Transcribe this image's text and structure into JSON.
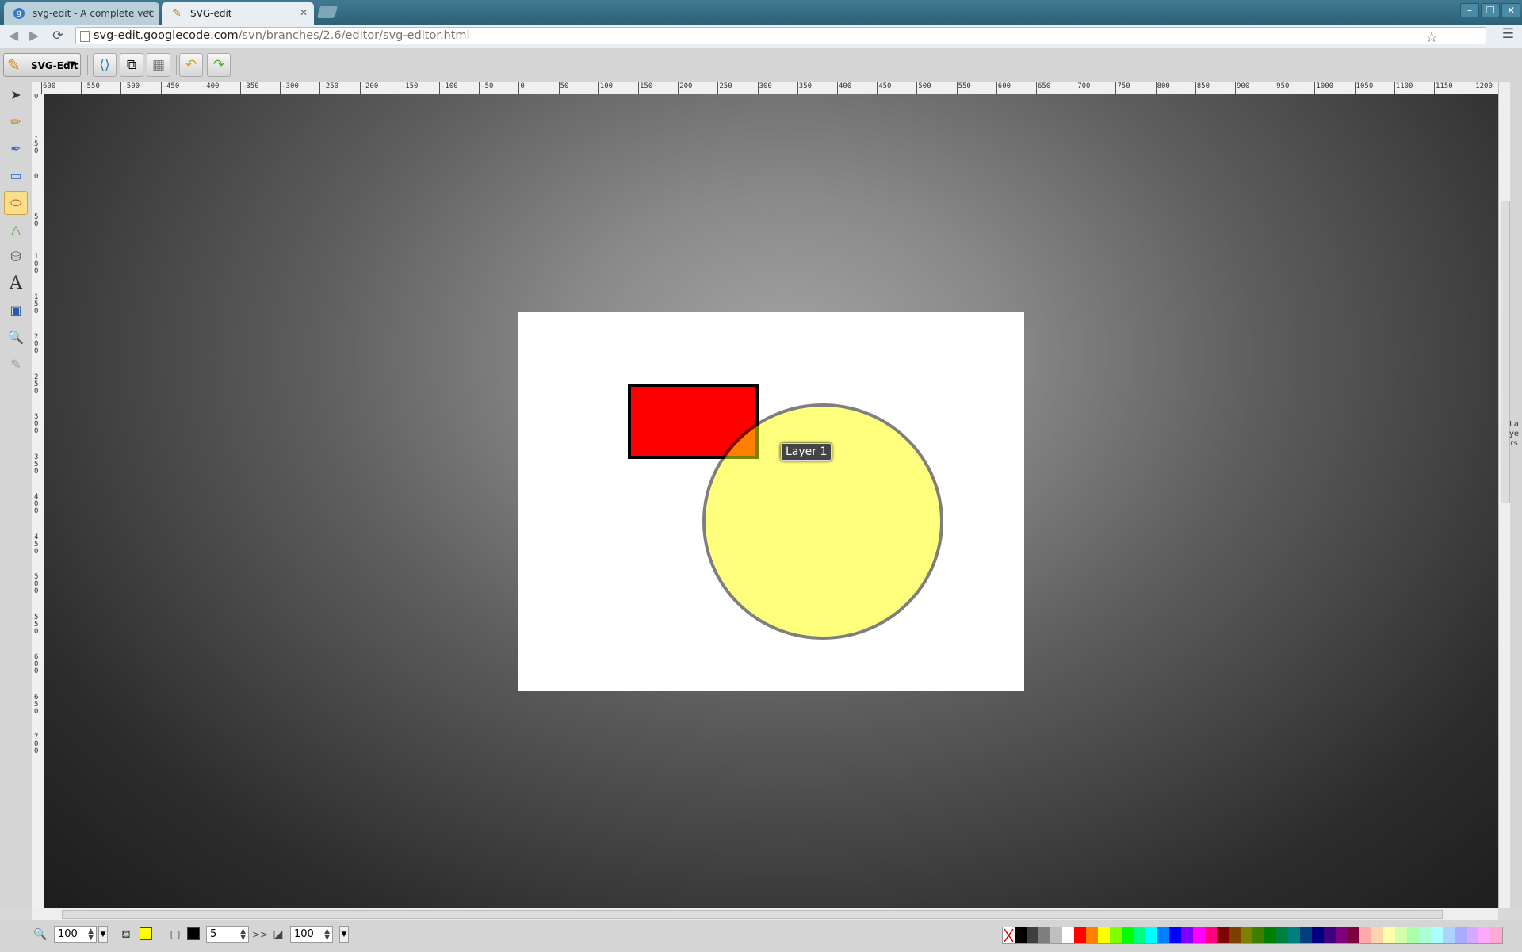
{
  "browser": {
    "tabs": [
      {
        "label": "svg-edit - A complete vec",
        "favicon": "google-code"
      },
      {
        "label": "SVG-edit",
        "favicon": "svg-edit"
      }
    ],
    "url_host": "svg-edit.googlecode.com",
    "url_path": "/svn/branches/2.6/editor/svg-editor.html",
    "window_controls": [
      "minimize",
      "restore",
      "close"
    ]
  },
  "toolbar": {
    "logo_label": "SVG-Edit",
    "buttons": [
      "source-icon",
      "wireframe-icon",
      "grid-icon",
      "undo-icon",
      "redo-icon"
    ]
  },
  "tools": [
    "select-icon",
    "pencil-icon",
    "pen-icon",
    "rect-icon",
    "ellipse-icon",
    "path-icon",
    "shapelib-icon",
    "text-icon",
    "image-icon",
    "zoom-icon",
    "eyedropper-icon"
  ],
  "active_tool": "ellipse-icon",
  "rulers": {
    "top": [
      "600",
      "-550",
      "-500",
      "-450",
      "-400",
      "-350",
      "-300",
      "-250",
      "-200",
      "-150",
      "-100",
      "-50",
      "0",
      "50",
      "100",
      "150",
      "200",
      "250",
      "300",
      "350",
      "400",
      "450",
      "500",
      "550",
      "600",
      "650",
      "700",
      "750",
      "800",
      "850",
      "900",
      "950",
      "1000",
      "1050",
      "1100",
      "1150",
      "1200"
    ],
    "left": [
      "0",
      "-50",
      "0",
      "50",
      "100",
      "150",
      "200",
      "250",
      "300",
      "350",
      "400",
      "450",
      "500",
      "550",
      "600",
      "650",
      "700"
    ]
  },
  "canvas": {
    "background": "#ffffff",
    "rect_fill": "#ff0000",
    "rect_stroke": "#000000",
    "ellipse_fill": "#ffff00",
    "ellipse_stroke": "#000000",
    "ellipse_opacity": "0.5"
  },
  "layer_tooltip": "Layer 1",
  "layers_panel_label": "Layers",
  "bottom": {
    "zoom": "100",
    "fill_color": "#ffff00",
    "stroke_color": "#000000",
    "stroke_width": "5",
    "more_label": ">>",
    "opacity": "100"
  },
  "palette": [
    "#000000",
    "#3f3f3f",
    "#7f7f7f",
    "#bfbfbf",
    "#ffffff",
    "#ff0000",
    "#ff7f00",
    "#ffff00",
    "#7fff00",
    "#00ff00",
    "#00ff7f",
    "#00ffff",
    "#007fff",
    "#0000ff",
    "#7f00ff",
    "#ff00ff",
    "#ff007f",
    "#7f0000",
    "#7f3f00",
    "#7f7f00",
    "#3f7f00",
    "#007f00",
    "#007f3f",
    "#007f7f",
    "#003f7f",
    "#00007f",
    "#3f007f",
    "#7f007f",
    "#7f003f",
    "#ffaaaa",
    "#ffd4aa",
    "#ffffaa",
    "#d4ffaa",
    "#aaffaa",
    "#aaffd4",
    "#aaffff",
    "#aad4ff",
    "#aaaaff",
    "#d4aaff",
    "#ffaaff",
    "#ffaad4"
  ]
}
